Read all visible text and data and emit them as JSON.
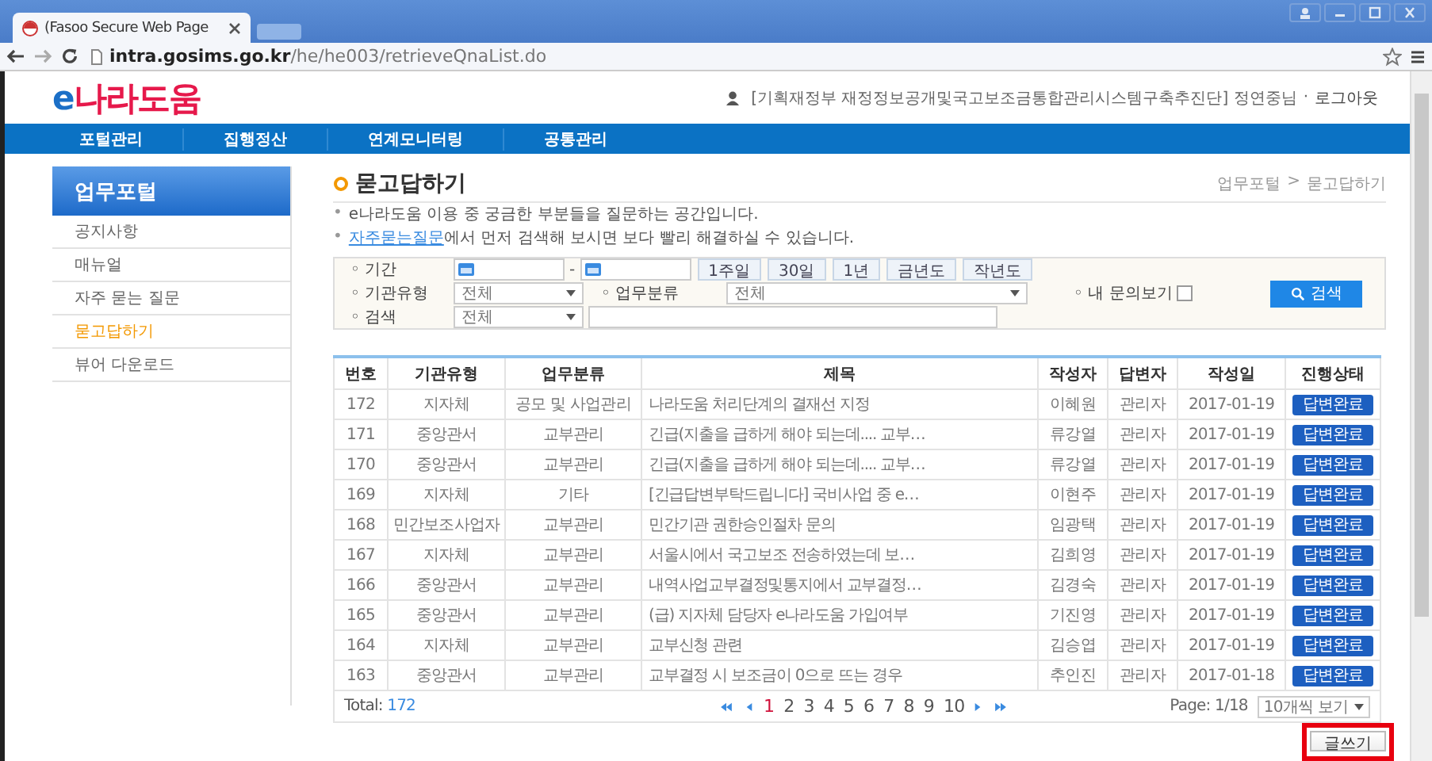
{
  "browser": {
    "tab_title": "(Fasoo Secure Web Page",
    "url_host": "intra.gosims.go.kr",
    "url_path": "/he/he003/retrieveQnaList.do"
  },
  "header": {
    "logo_prefix": "e",
    "logo": "나라도움",
    "user": "[기획재정부 재정정보공개및국고보조금통합관리시스템구축추진단] 정연중님",
    "separator": "·",
    "logout": "로그아웃"
  },
  "nav": [
    "포털관리",
    "집행정산",
    "연계모니터링",
    "공통관리"
  ],
  "sidebar": {
    "title": "업무포털",
    "items": [
      {
        "label": "공지사항",
        "selected": false
      },
      {
        "label": "매뉴얼",
        "selected": false
      },
      {
        "label": "자주 묻는 질문",
        "selected": false
      },
      {
        "label": "묻고답하기",
        "selected": true
      },
      {
        "label": "뷰어 다운로드",
        "selected": false
      }
    ]
  },
  "page": {
    "title": "묻고답하기",
    "breadcrumb": [
      "업무포털",
      "묻고답하기"
    ],
    "breadcrumb_sep": ">",
    "note_bullets": [
      "•",
      "•"
    ],
    "note": "e나라도움 이용 중 궁금한 부분들을 질문하는 공간입니다.",
    "note_link": "자주묻는질문",
    "note_rest": "에서 먼저 검색해 보시면 보다 빨리 해결하실 수 있습니다."
  },
  "search": {
    "period_label": "◦ 기간",
    "date_sep": "-",
    "ranges": [
      "1주일",
      "30일",
      "1년",
      "금년도",
      "작년도"
    ],
    "org_label": "◦ 기관유형",
    "org_value": "전체",
    "cat_label": "◦ 업무분류",
    "cat_value": "전체",
    "mine_label": "◦ 내 문의보기",
    "mine_checked": false,
    "keyword_label": "◦ 검색",
    "keyword_scope": "전체",
    "button": "검색"
  },
  "table": {
    "columns": [
      "번호",
      "기관유형",
      "업무분류",
      "제목",
      "작성자",
      "답변자",
      "작성일",
      "진행상태"
    ],
    "rows": [
      [
        "172",
        "지자체",
        "공모 및 사업관리",
        "나라도움 처리단계의 결재선 지정",
        "이혜원",
        "관리자",
        "2017-01-19",
        "답변완료"
      ],
      [
        "171",
        "중앙관서",
        "교부관리",
        "긴급(지출을 급하게 해야 되는데.... 교부…",
        "류강열",
        "관리자",
        "2017-01-19",
        "답변완료"
      ],
      [
        "170",
        "중앙관서",
        "교부관리",
        "긴급(지출을 급하게 해야 되는데.... 교부…",
        "류강열",
        "관리자",
        "2017-01-19",
        "답변완료"
      ],
      [
        "169",
        "지자체",
        "기타",
        "[긴급답변부탁드립니다] 국비사업 중 e…",
        "이현주",
        "관리자",
        "2017-01-19",
        "답변완료"
      ],
      [
        "168",
        "민간보조사업자",
        "교부관리",
        "민간기관 권한승인절차 문의",
        "임광택",
        "관리자",
        "2017-01-19",
        "답변완료"
      ],
      [
        "167",
        "지자체",
        "교부관리",
        "서울시에서 국고보조 전송하였는데 보…",
        "김희영",
        "관리자",
        "2017-01-19",
        "답변완료"
      ],
      [
        "166",
        "중앙관서",
        "교부관리",
        "내역사업교부결정및통지에서 교부결정…",
        "김경숙",
        "관리자",
        "2017-01-19",
        "답변완료"
      ],
      [
        "165",
        "중앙관서",
        "교부관리",
        "(급) 지자체 담당자 e나라도움 가입여부",
        "기진영",
        "관리자",
        "2017-01-19",
        "답변완료"
      ],
      [
        "164",
        "지자체",
        "교부관리",
        "교부신청 관련",
        "김승엽",
        "관리자",
        "2017-01-19",
        "답변완료"
      ],
      [
        "163",
        "중앙관서",
        "교부관리",
        "교부결정 시 보조금이 0으로 뜨는 경우",
        "추인진",
        "관리자",
        "2017-01-18",
        "답변완료"
      ]
    ]
  },
  "footer": {
    "total_label": "Total:",
    "total": "172",
    "pages": [
      {
        "label": "1",
        "selected": true
      },
      {
        "label": "2",
        "selected": false
      },
      {
        "label": "3",
        "selected": false
      },
      {
        "label": "4",
        "selected": false
      },
      {
        "label": "5",
        "selected": false
      },
      {
        "label": "6",
        "selected": false
      },
      {
        "label": "7",
        "selected": false
      },
      {
        "label": "8",
        "selected": false
      },
      {
        "label": "9",
        "selected": false
      },
      {
        "label": "10",
        "selected": false
      }
    ],
    "page_info": "Page: 1/18",
    "per_page": "10개씩 보기"
  },
  "write": {
    "label": "글쓰기",
    "highlighted": true
  }
}
